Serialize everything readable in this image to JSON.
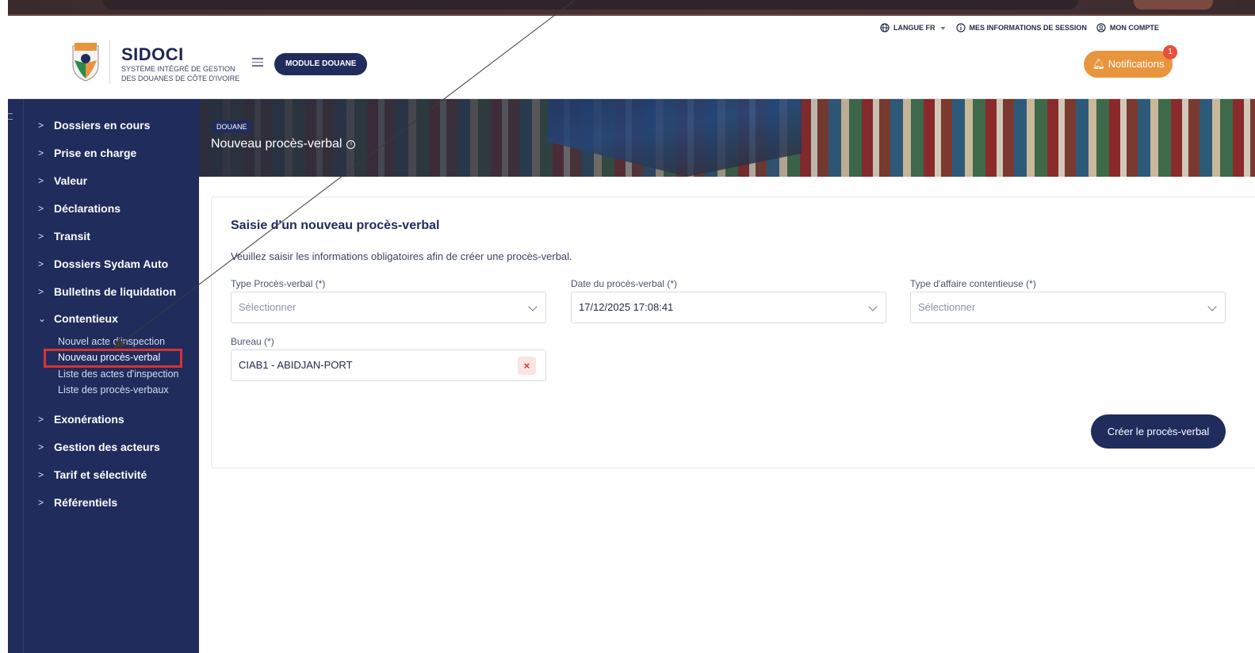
{
  "header": {
    "brand_title": "SIDOCI",
    "brand_subtitle_line1": "SYSTÈME INTÉGRÉ DE GESTION",
    "brand_subtitle_line2": "DES DOUANES DE CÔTE D'IVOIRE",
    "module_button": "MODULE DOUANE",
    "language_link": "LANGUE FR",
    "session_link": "MES INFORMATIONS DE SESSION",
    "account_link": "MON COMPTE",
    "notifications_label": "Notifications",
    "notifications_count": "1"
  },
  "sidebar": {
    "items": [
      {
        "label": "Dossiers en cours",
        "chevron": ">"
      },
      {
        "label": "Prise en charge",
        "chevron": ">"
      },
      {
        "label": "Valeur",
        "chevron": ">"
      },
      {
        "label": "Déclarations",
        "chevron": ">"
      },
      {
        "label": "Transit",
        "chevron": ">"
      },
      {
        "label": "Dossiers Sydam Auto",
        "chevron": ">"
      },
      {
        "label": "Bulletins de liquidation",
        "chevron": ">"
      },
      {
        "label": "Contentieux",
        "chevron": "⌄"
      },
      {
        "label": "Exonérations",
        "chevron": ">"
      },
      {
        "label": "Gestion des acteurs",
        "chevron": ">"
      },
      {
        "label": "Tarif et sélectivité",
        "chevron": ">"
      },
      {
        "label": "Référentiels",
        "chevron": ">"
      }
    ],
    "contentieux_subitems": [
      {
        "label": "Nouvel acte d'inspection"
      },
      {
        "label": "Nouveau procès-verbal"
      },
      {
        "label": "Liste des actes d'inspection"
      },
      {
        "label": "Liste des procès-verbaux"
      }
    ]
  },
  "banner": {
    "tag": "DOUANE",
    "title": "Nouveau procès-verbal"
  },
  "form": {
    "title": "Saisie d'un nouveau procès-verbal",
    "description": "Veuillez saisir les informations obligatoires afin de créer une procès-verbal.",
    "type_pv_label": "Type Procès-verbal (*)",
    "type_pv_placeholder": "Sélectionner",
    "date_label": "Date du procès-verbal (*)",
    "date_value": "17/12/2025 17:08:41",
    "affaire_label": "Type d'affaire contentieuse (*)",
    "affaire_placeholder": "Sélectionner",
    "bureau_label": "Bureau (*)",
    "bureau_value": "CIAB1 - ABIDJAN-PORT",
    "clear_symbol": "×",
    "submit_label": "Créer le procès-verbal"
  },
  "colors": {
    "navy": "#1f2c5c",
    "orange": "#e8953d",
    "highlight_red": "#d93232"
  },
  "icons": [
    "globe-icon",
    "caret-down-icon",
    "info-icon",
    "user-circle-icon",
    "bell-icon",
    "menu-icon",
    "chevron-right-icon",
    "chevron-down-icon",
    "close-icon"
  ]
}
